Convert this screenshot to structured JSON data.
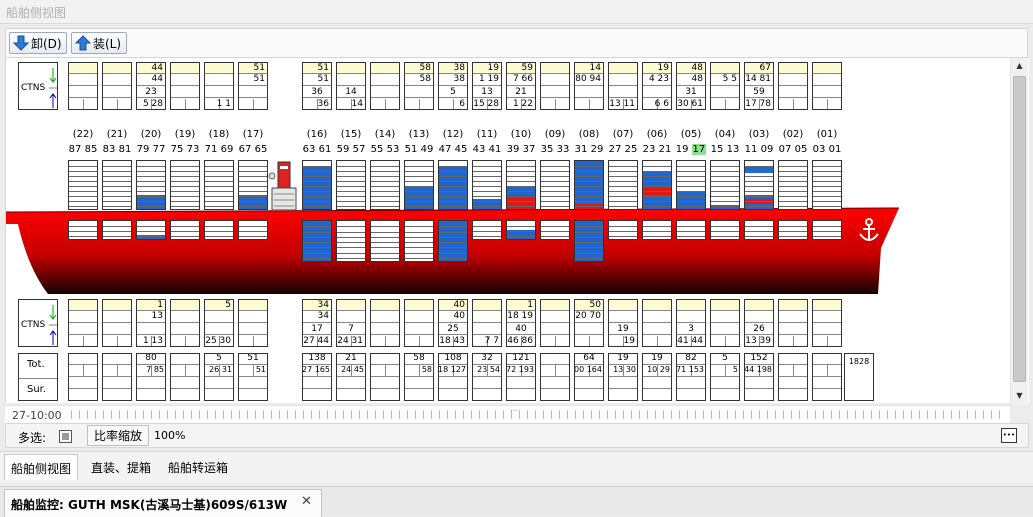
{
  "window": {
    "title": "船舶侧视图"
  },
  "toolbar": {
    "unload_label": "卸(D)",
    "load_label": "装(L)"
  },
  "ctns_label": "CTNS",
  "tot_label": "Tot.",
  "sur_label": "Sur.",
  "total_value": "1828",
  "bays": [
    {
      "pair": "(22)",
      "nums": "87 85",
      "top": {
        "a": "",
        "b": "",
        "c": "",
        "d": ""
      },
      "bot": {
        "a": "",
        "b": "",
        "c": "",
        "d": ""
      },
      "sum": {
        "a": "",
        "b": "",
        "c": ""
      }
    },
    {
      "pair": "(21)",
      "nums": "83 81",
      "top": {
        "a": "",
        "b": "",
        "c": "",
        "d": ""
      },
      "bot": {
        "a": "",
        "b": "",
        "c": "",
        "d": ""
      },
      "sum": {
        "a": "",
        "b": "",
        "c": ""
      }
    },
    {
      "pair": "(20)",
      "nums": "79 77",
      "top": {
        "a": "44",
        "b": "44",
        "c": "23",
        "d": "5 28"
      },
      "bot": {
        "a": "1",
        "b": "13",
        "c": "",
        "d": "1 13"
      },
      "sum": {
        "a": "80",
        "b": "7 85",
        "c": ""
      }
    },
    {
      "pair": "(19)",
      "nums": "75 73",
      "top": {
        "a": "",
        "b": "",
        "c": "",
        "d": ""
      },
      "bot": {
        "a": "",
        "b": "",
        "c": "",
        "d": ""
      },
      "sum": {
        "a": "",
        "b": "",
        "c": ""
      }
    },
    {
      "pair": "(18)",
      "nums": "71 69",
      "top": {
        "a": "",
        "b": "",
        "c": "",
        "d": "1 1"
      },
      "bot": {
        "a": "5",
        "b": "",
        "c": "",
        "d": "25 30"
      },
      "sum": {
        "a": "5",
        "b": "26 31",
        "c": ""
      }
    },
    {
      "pair": "(17)",
      "nums": "67 65",
      "top": {
        "a": "51",
        "b": "51",
        "c": "",
        "d": ""
      },
      "bot": {
        "a": "",
        "b": "",
        "c": "",
        "d": ""
      },
      "sum": {
        "a": "51",
        "b": "51",
        "c": ""
      }
    },
    {
      "pair": "(16)",
      "nums": "63 61",
      "top": {
        "a": "51",
        "b": "51",
        "c": "36",
        "d": "36"
      },
      "bot": {
        "a": "34",
        "b": "34",
        "c": "17",
        "d": "27 44"
      },
      "sum": {
        "a": "138",
        "b": "27 165",
        "c": ""
      }
    },
    {
      "pair": "(15)",
      "nums": "59 57",
      "top": {
        "a": "",
        "b": "",
        "c": "14",
        "d": "14"
      },
      "bot": {
        "a": "",
        "b": "",
        "c": "7",
        "d": "24 31"
      },
      "sum": {
        "a": "21",
        "b": "24 45",
        "c": ""
      }
    },
    {
      "pair": "(14)",
      "nums": "55 53",
      "top": {
        "a": "",
        "b": "",
        "c": "",
        "d": ""
      },
      "bot": {
        "a": "",
        "b": "",
        "c": "",
        "d": ""
      },
      "sum": {
        "a": "",
        "b": "",
        "c": ""
      }
    },
    {
      "pair": "(13)",
      "nums": "51 49",
      "top": {
        "a": "58",
        "b": "58",
        "c": "",
        "d": ""
      },
      "bot": {
        "a": "",
        "b": "",
        "c": "",
        "d": ""
      },
      "sum": {
        "a": "58",
        "b": "58",
        "c": ""
      }
    },
    {
      "pair": "(12)",
      "nums": "47 45",
      "top": {
        "a": "38",
        "b": "38",
        "c": "5",
        "d": "6"
      },
      "bot": {
        "a": "40",
        "b": "40",
        "c": "25",
        "d": "18 43"
      },
      "sum": {
        "a": "108",
        "b": "18 127",
        "c": ""
      }
    },
    {
      "pair": "(11)",
      "nums": "43 41",
      "top": {
        "a": "19",
        "b": "1 19",
        "c": "13",
        "d": "15 28"
      },
      "bot": {
        "a": "",
        "b": "",
        "c": "",
        "d": "7 7"
      },
      "sum": {
        "a": "32",
        "b": "23 54",
        "c": ""
      }
    },
    {
      "pair": "(10)",
      "nums": "39 37",
      "top": {
        "a": "59",
        "b": "7 66",
        "c": "21",
        "d": "1 22"
      },
      "bot": {
        "a": "1",
        "b": "18 19",
        "c": "40",
        "d": "46 86"
      },
      "sum": {
        "a": "121",
        "b": "72 193",
        "c": ""
      }
    },
    {
      "pair": "(09)",
      "nums": "35 33",
      "top": {
        "a": "",
        "b": "",
        "c": "",
        "d": ""
      },
      "bot": {
        "a": "",
        "b": "",
        "c": "",
        "d": ""
      },
      "sum": {
        "a": "",
        "b": "",
        "c": ""
      }
    },
    {
      "pair": "(08)",
      "nums": "31 29",
      "top": {
        "a": "14",
        "b": "80 94",
        "c": "",
        "d": ""
      },
      "bot": {
        "a": "50",
        "b": "20 70",
        "c": "",
        "d": ""
      },
      "sum": {
        "a": "64",
        "b": "100 164",
        "c": ""
      }
    },
    {
      "pair": "(07)",
      "nums": "27 25",
      "top": {
        "a": "",
        "b": "",
        "c": "",
        "d": "13 11"
      },
      "bot": {
        "a": "",
        "b": "",
        "c": "19",
        "d": "19"
      },
      "sum": {
        "a": "19",
        "b": "13 30",
        "c": ""
      }
    },
    {
      "pair": "(06)",
      "nums": "23 21",
      "top": {
        "a": "19",
        "b": "4 23",
        "c": "",
        "d": "6 6"
      },
      "bot": {
        "a": "",
        "b": "",
        "c": "",
        "d": ""
      },
      "sum": {
        "a": "19",
        "b": "10 29",
        "c": ""
      }
    },
    {
      "pair": "(05)",
      "nums": "19",
      "nums_hl": "17",
      "top": {
        "a": "48",
        "b": "48",
        "c": "31",
        "d": "30 61"
      },
      "bot": {
        "a": "",
        "b": "",
        "c": "3",
        "d": "41 44"
      },
      "sum": {
        "a": "82",
        "b": "71 153",
        "c": ""
      }
    },
    {
      "pair": "(04)",
      "nums": "15 13",
      "top": {
        "a": "",
        "b": "5 5",
        "c": "",
        "d": ""
      },
      "bot": {
        "a": "",
        "b": "",
        "c": "",
        "d": ""
      },
      "sum": {
        "a": "5",
        "b": "5",
        "c": ""
      }
    },
    {
      "pair": "(03)",
      "nums": "11 09",
      "top": {
        "a": "67",
        "b": "14 81",
        "c": "59",
        "d": "17 78"
      },
      "bot": {
        "a": "",
        "b": "",
        "c": "26",
        "d": "13 39"
      },
      "sum": {
        "a": "152",
        "b": "44 198",
        "c": ""
      }
    },
    {
      "pair": "(02)",
      "nums": "07 05",
      "top": {
        "a": "",
        "b": "",
        "c": "",
        "d": ""
      },
      "bot": {
        "a": "",
        "b": "",
        "c": "",
        "d": ""
      },
      "sum": {
        "a": "",
        "b": "",
        "c": ""
      }
    },
    {
      "pair": "(01)",
      "nums": "03 01",
      "top": {
        "a": "",
        "b": "",
        "c": "",
        "d": ""
      },
      "bot": {
        "a": "",
        "b": "",
        "c": "",
        "d": ""
      },
      "sum": {
        "a": "",
        "b": "",
        "c": ""
      }
    }
  ],
  "timestamp": "27-10:00",
  "status": {
    "multi_select_label": "多选:",
    "zoom_button_label": "比率缩放",
    "zoom_value": "100%"
  },
  "tabs": [
    {
      "label": "船舶侧视图"
    },
    {
      "label": "直装、提箱"
    },
    {
      "label": "船舶转运箱"
    }
  ],
  "document_tab": {
    "label": "船舶监控: GUTH MSK(古溪马士基)609S/613W"
  },
  "colors": {
    "loaded": "#1f66d1",
    "hazard": "#e01818",
    "header_yellow": "#fdfbd1",
    "hull_red": "#e00000",
    "highlight": "#8ee08e"
  }
}
